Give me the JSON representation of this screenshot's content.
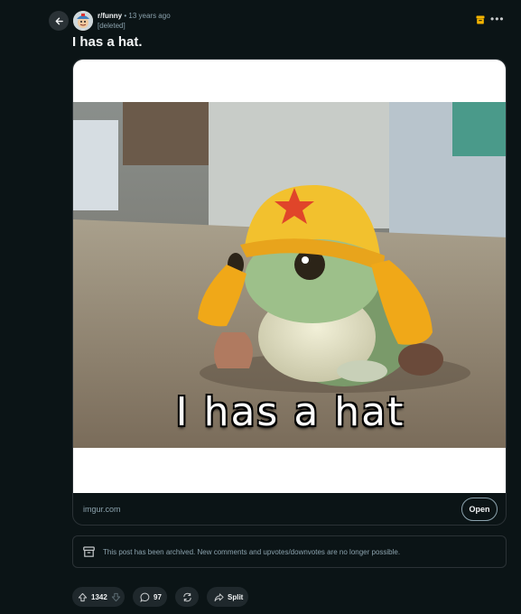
{
  "header": {
    "subreddit": "r/funny",
    "separator": "•",
    "time_ago": "13 years ago",
    "author": "[deleted]"
  },
  "post": {
    "title": "I has a hat.",
    "image_caption": "I has a hat",
    "link_domain": "imgur.com",
    "open_label": "Open"
  },
  "archived_notice": "This post has been archived. New comments and upvotes/downvotes are no longer possible.",
  "actions": {
    "votes": "1342",
    "comments": "97",
    "share_label": "Split"
  },
  "icons": {
    "back": "arrow-left-icon",
    "archive": "archive-box-icon",
    "more": "more-horizontal-icon",
    "upvote": "upvote-arrow-icon",
    "downvote": "downvote-arrow-icon",
    "comment": "speech-bubble-icon",
    "award": "repost-icon",
    "share": "share-arrow-icon"
  },
  "colors": {
    "background": "#0b1416",
    "archive_accent": "#f5b400",
    "pill_bg": "#1f282c",
    "muted_text": "#8ba2ad"
  }
}
